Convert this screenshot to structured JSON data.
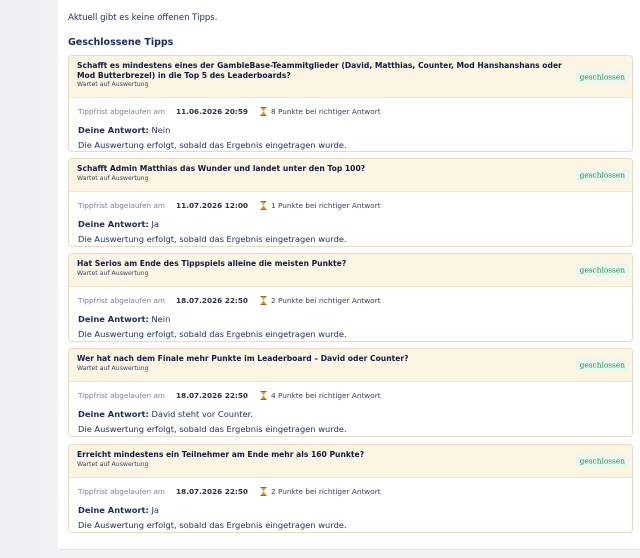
{
  "notice": "Aktuell gibt es keine offenen Tipps.",
  "section_title": "Geschlossene Tipps",
  "labels": {
    "deadline": "Tippfrist abgelaufen am",
    "your_answer": "Deine Antwort:",
    "evaluation": "Die Auswertung erfolgt, sobald das Ergebnis eingetragen wurde.",
    "status": "Wartet auf Auswertung",
    "badge": "geschlossen"
  },
  "colors": {
    "header_bg": "#fdf5e3",
    "badge_bg": "#e9f7ee",
    "badge_text": "#2a8a4a",
    "text": "#1c2b5e"
  },
  "tips": [
    {
      "question": "Schafft es mindestens eines der GambleBase-Teammitglieder (David, Matthias, Counter, Mod Hanshanshans oder Mod Butterbrezel) in die Top 5 des Leaderboards?",
      "deadline": "11.06.2026 20:59",
      "points": "8 Punkte bei richtiger Antwort",
      "answer": "Nein"
    },
    {
      "question": "Schafft Admin Matthias das Wunder und landet unter den Top 100?",
      "deadline": "11.07.2026 12:00",
      "points": "1 Punkte bei richtiger Antwort",
      "answer": "Ja"
    },
    {
      "question": "Hat Serios am Ende des Tippspiels alleine die meisten Punkte?",
      "deadline": "18.07.2026 22:50",
      "points": "2 Punkte bei richtiger Antwort",
      "answer": "Nein"
    },
    {
      "question": "Wer hat nach dem Finale mehr Punkte im Leaderboard – David oder Counter?",
      "deadline": "18.07.2026 22:50",
      "points": "4 Punkte bei richtiger Antwort",
      "answer": "David steht vor Counter."
    },
    {
      "question": "Erreicht mindestens ein Teilnehmer am Ende mehr als 160 Punkte?",
      "deadline": "18.07.2026 22:50",
      "points": "2 Punkte bei richtiger Antwort",
      "answer": "Ja"
    }
  ]
}
